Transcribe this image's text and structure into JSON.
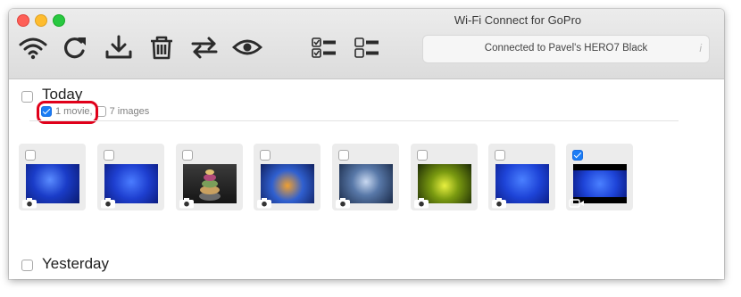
{
  "window": {
    "title": "Wi-Fi Connect for GoPro"
  },
  "toolbar": {
    "icons": [
      "wifi-icon",
      "refresh-icon",
      "download-icon",
      "trash-icon",
      "sync-icon",
      "eye-icon",
      "select-all-icon",
      "deselect-all-icon"
    ],
    "status": "Connected to Pavel's HERO7 Black",
    "info": "i"
  },
  "sections": [
    {
      "title": "Today",
      "filters": [
        {
          "label": "1 movie,",
          "checked": true
        },
        {
          "label": "7 images",
          "checked": false
        }
      ],
      "items": [
        {
          "type": "image",
          "checked": false
        },
        {
          "type": "image",
          "checked": false
        },
        {
          "type": "image",
          "checked": false
        },
        {
          "type": "image",
          "checked": false
        },
        {
          "type": "image",
          "checked": false
        },
        {
          "type": "image",
          "checked": false
        },
        {
          "type": "image",
          "checked": false
        },
        {
          "type": "movie",
          "checked": true
        }
      ]
    },
    {
      "title": "Yesterday"
    }
  ],
  "colors": {
    "accent": "#1a7cf5",
    "highlight": "#e0001a"
  }
}
